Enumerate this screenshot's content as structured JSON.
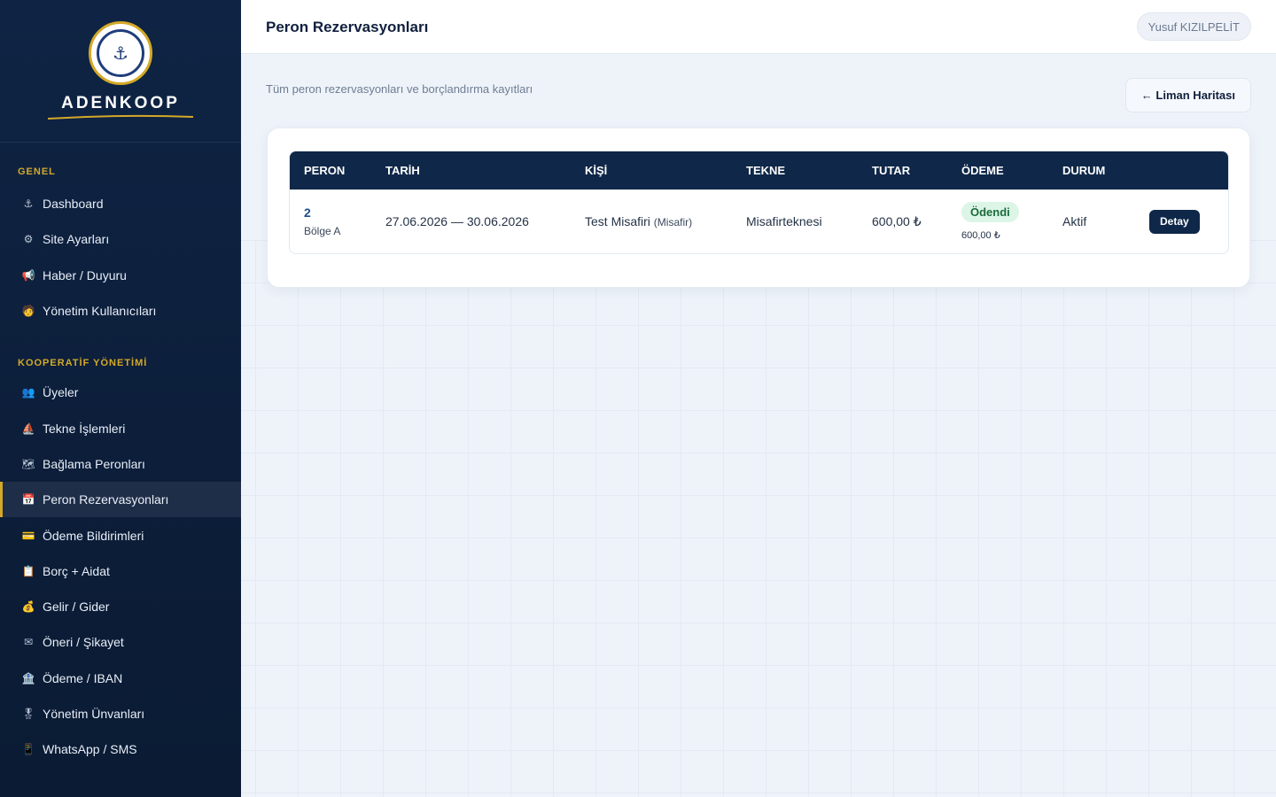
{
  "sidebar": {
    "brand": "ADENKOOP",
    "sections": [
      {
        "title": "GENEL",
        "items": [
          {
            "label": "Dashboard",
            "icon": "⚓"
          },
          {
            "label": "Site Ayarları",
            "icon": "⚙"
          },
          {
            "label": "Haber / Duyuru",
            "icon": "📢"
          },
          {
            "label": "Yönetim Kullanıcıları",
            "icon": "🧑"
          }
        ]
      },
      {
        "title": "KOOPERATİF YÖNETİMİ",
        "items": [
          {
            "label": "Üyeler",
            "icon": "👥"
          },
          {
            "label": "Tekne İşlemleri",
            "icon": "⛵"
          },
          {
            "label": "Bağlama Peronları",
            "icon": "🗺"
          },
          {
            "label": "Peron Rezervasyonları",
            "icon": "📅"
          },
          {
            "label": "Ödeme Bildirimleri",
            "icon": "💳"
          },
          {
            "label": "Borç + Aidat",
            "icon": "📋"
          },
          {
            "label": "Gelir / Gider",
            "icon": "💰"
          },
          {
            "label": "Öneri / Şikayet",
            "icon": "✉"
          },
          {
            "label": "Ödeme / IBAN",
            "icon": "🏦"
          },
          {
            "label": "Yönetim Ünvanları",
            "icon": "🎖"
          },
          {
            "label": "WhatsApp / SMS",
            "icon": "📱"
          }
        ]
      }
    ]
  },
  "header": {
    "title": "Peron Rezervasyonları",
    "user": "Yusuf KIZILPELİT"
  },
  "main": {
    "subtitle": "Tüm peron rezervasyonları ve borçlandırma kayıtları",
    "map_button": "← Liman Haritası",
    "table": {
      "columns": [
        "PERON",
        "TARİH",
        "KİŞİ",
        "TEKNE",
        "TUTAR",
        "ÖDEME",
        "DURUM",
        ""
      ],
      "rows": [
        {
          "peron": "2",
          "zone": "Bölge A",
          "date": "27.06.2026 — 30.06.2026",
          "person": "Test Misafiri",
          "person_type": "(Misafir)",
          "boat": "Misafirteknesi",
          "amount": "600,00 ₺",
          "payment_status": "Ödendi",
          "payment_amount": "600,00 ₺",
          "status": "Aktif",
          "action": "Detay"
        }
      ]
    }
  },
  "colors": {
    "sidebar_bg": "#0f2444",
    "accent_gold": "#d4a929",
    "header_navy": "#0f2748",
    "paid_green": "#dcf5e6"
  }
}
